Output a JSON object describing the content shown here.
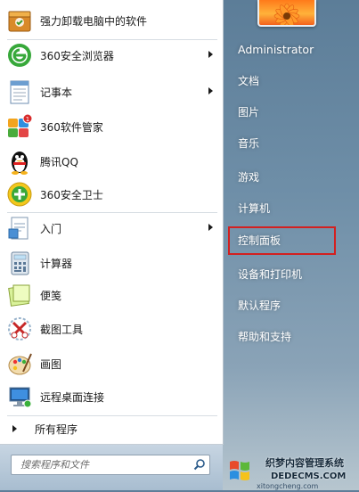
{
  "programs": [
    {
      "label": "强力卸载电脑中的软件",
      "has_arrow": false,
      "icon": "uninstall-box-icon"
    },
    {
      "label": "360安全浏览器",
      "has_arrow": true,
      "icon": "360-browser-icon"
    },
    {
      "label": "记事本",
      "has_arrow": true,
      "icon": "notepad-icon"
    },
    {
      "label": "360软件管家",
      "has_arrow": false,
      "icon": "360-software-manager-icon",
      "badge": "1"
    },
    {
      "label": "腾讯QQ",
      "has_arrow": false,
      "icon": "qq-penguin-icon"
    },
    {
      "label": "360安全卫士",
      "has_arrow": false,
      "icon": "360-security-icon"
    },
    {
      "label": "入门",
      "has_arrow": true,
      "icon": "getting-started-icon"
    },
    {
      "label": "计算器",
      "has_arrow": false,
      "icon": "calculator-icon"
    },
    {
      "label": "便笺",
      "has_arrow": false,
      "icon": "sticky-notes-icon"
    },
    {
      "label": "截图工具",
      "has_arrow": false,
      "icon": "snipping-tool-icon"
    },
    {
      "label": "画图",
      "has_arrow": false,
      "icon": "paint-palette-icon"
    },
    {
      "label": "远程桌面连接",
      "has_arrow": false,
      "icon": "remote-desktop-icon"
    }
  ],
  "all_programs": "所有程序",
  "search": {
    "placeholder": "搜索程序和文件"
  },
  "right": {
    "user": "Administrator",
    "items": [
      "文档",
      "图片",
      "音乐",
      "游戏",
      "计算机",
      "控制面板",
      "设备和打印机",
      "默认程序",
      "帮助和支持"
    ]
  },
  "watermark": {
    "line1": "织梦内容管理系统",
    "line2": "DEDECMS.COM",
    "line3": "xitongcheng.com"
  },
  "colors": {
    "highlight": "#d32020",
    "right_pane": "#6f8fa8"
  }
}
